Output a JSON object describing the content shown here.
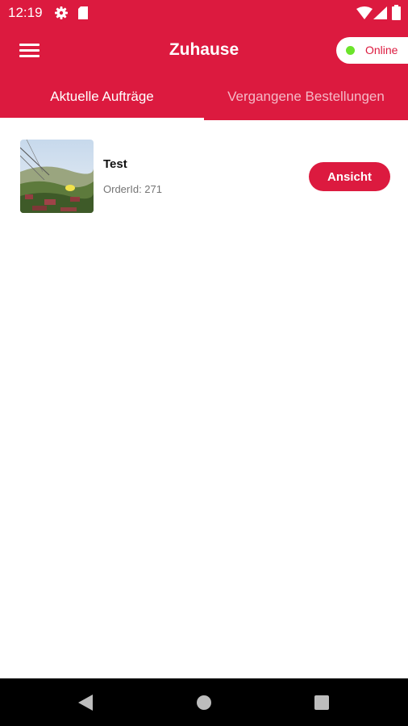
{
  "status_bar": {
    "time": "12:19",
    "icons": [
      "settings-icon",
      "sd-card-icon",
      "wifi-icon",
      "signal-icon",
      "battery-icon"
    ]
  },
  "app_bar": {
    "title": "Zuhause",
    "menu_icon": "hamburger-menu-icon",
    "status_toggle": {
      "label": "Online",
      "indicator_color": "#6be42b"
    }
  },
  "tabs": [
    {
      "label": "Aktuelle Aufträge",
      "active": true
    },
    {
      "label": "Vergangene Bestellungen",
      "active": false
    }
  ],
  "orders": [
    {
      "name": "Test",
      "order_id_text": "OrderId: 271",
      "button_label": "Ansicht"
    }
  ],
  "nav_bar": {
    "icons": [
      "back-icon",
      "home-icon",
      "recents-icon"
    ]
  },
  "colors": {
    "brand": "#dc1a3f",
    "inactive_tab_text": "#f5b9c7",
    "online": "#6be42b"
  }
}
